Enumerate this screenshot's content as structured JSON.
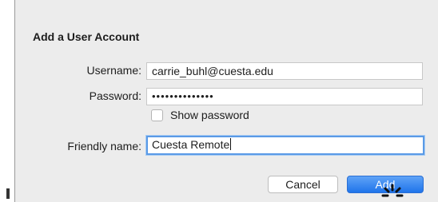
{
  "dialog": {
    "title": "Add a User Account",
    "username": {
      "label": "Username:",
      "value": "carrie_buhl@cuesta.edu"
    },
    "password": {
      "label": "Password:",
      "value": "••••••••••••••"
    },
    "show_password": {
      "label": "Show password",
      "checked": false
    },
    "friendly_name": {
      "label": "Friendly name:",
      "value": "Cuesta Remote"
    },
    "buttons": {
      "cancel": "Cancel",
      "add": "Add"
    }
  },
  "colors": {
    "accent": "#1f74ea",
    "focus_ring": "#5a9ae6",
    "background": "#ececec"
  },
  "icons": {
    "cursor": "busy-cursor-icon"
  }
}
